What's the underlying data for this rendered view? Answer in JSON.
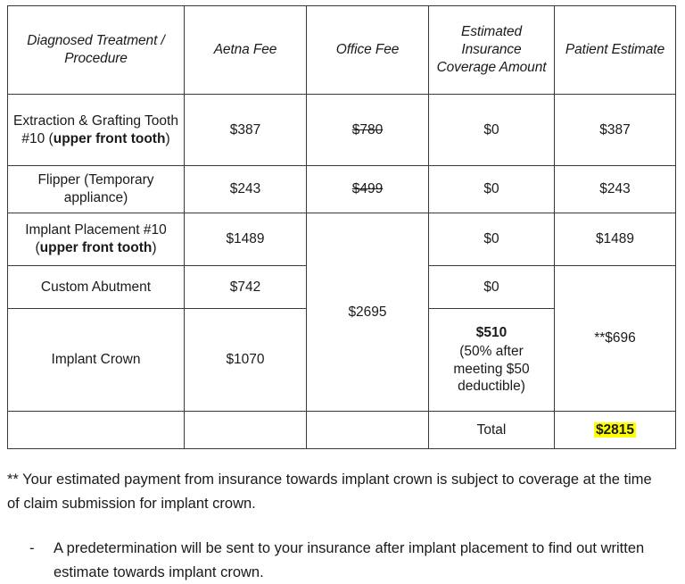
{
  "table": {
    "headers": [
      "Diagnosed Treatment / Procedure",
      "Aetna Fee",
      "Office Fee",
      "Estimated Insurance Coverage Amount",
      "Patient Estimate"
    ],
    "rows": [
      {
        "procedure_plain": "Extraction & Grafting Tooth #10 (",
        "procedure_bold": "upper front tooth",
        "procedure_tail": ")",
        "aetna_fee": "$387",
        "office_fee": "$780",
        "office_fee_struck": true,
        "insurance": "$0",
        "patient_estimate": "$387"
      },
      {
        "procedure_plain": "Flipper (Temporary appliance)",
        "procedure_bold": "",
        "procedure_tail": "",
        "aetna_fee": "$243",
        "office_fee": "$499",
        "office_fee_struck": true,
        "insurance": "$0",
        "patient_estimate": "$243"
      },
      {
        "procedure_plain": "Implant Placement #10 (",
        "procedure_bold": "upper front tooth",
        "procedure_tail": ")",
        "aetna_fee": "$1489",
        "office_fee": "",
        "office_fee_struck": false,
        "insurance": "$0",
        "patient_estimate": "$1489"
      },
      {
        "procedure_plain": "Custom Abutment",
        "procedure_bold": "",
        "procedure_tail": "",
        "aetna_fee": "$742",
        "office_fee": "",
        "office_fee_struck": false,
        "insurance": "$0",
        "patient_estimate": ""
      },
      {
        "procedure_plain": "Implant Crown",
        "procedure_bold": "",
        "procedure_tail": "",
        "aetna_fee": "$1070",
        "office_fee": "",
        "office_fee_struck": false,
        "insurance": "$510",
        "patient_estimate": ""
      }
    ],
    "office_fee_merged": "$2695",
    "insurance_crown_amount": "$510",
    "insurance_crown_note": "(50% after meeting $50 deductible)",
    "patient_estimate_crown": "**$696",
    "total_label": "Total",
    "total_value": "$2815",
    "total_highlight_color": "#FFFF00"
  },
  "footnotes": {
    "asterisk_note": "** Your estimated payment from insurance towards implant crown is subject to coverage at the time of claim submission for implant crown.",
    "bullet_dash": "-",
    "bullet_note": "A predetermination will be sent to your insurance after implant placement to find out written estimate towards implant crown."
  }
}
